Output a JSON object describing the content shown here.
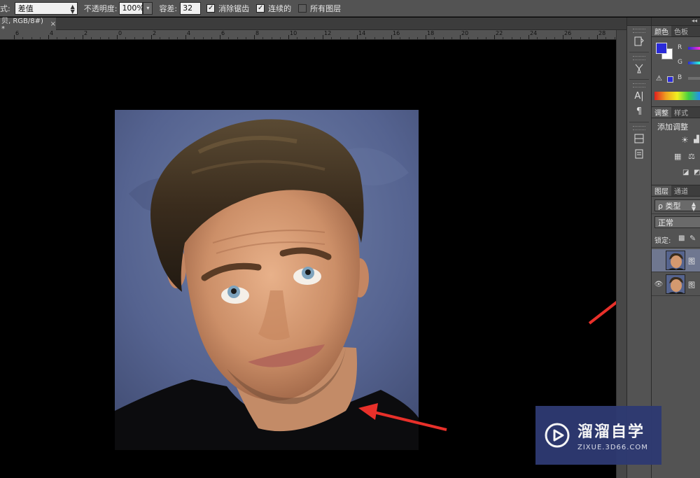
{
  "options_bar": {
    "mode_label": "式:",
    "mode_value": "差值",
    "opacity_label": "不透明度:",
    "opacity_value": "100%",
    "tolerance_label": "容差:",
    "tolerance_value": "32",
    "antialias_label": "消除锯齿",
    "antialias_checked": true,
    "contiguous_label": "连续的",
    "contiguous_checked": true,
    "all_layers_label": "所有图层",
    "all_layers_checked": false
  },
  "document_tab": {
    "title": "贝, RGB/8#) *",
    "close": "×"
  },
  "ruler": {
    "labels": [
      "6",
      "4",
      "2",
      "0",
      "2",
      "4",
      "6",
      "8",
      "10",
      "12",
      "14",
      "16",
      "18",
      "20",
      "22",
      "24",
      "26",
      "28"
    ]
  },
  "icon_strip": {
    "icons": [
      "history-icon",
      "brush-presets-icon",
      "character-icon",
      "paragraph-icon",
      "layer-comps-icon",
      "notes-icon"
    ],
    "glyphs": {
      "character": "A|",
      "paragraph": "¶"
    }
  },
  "color_panel": {
    "tabs": [
      "颜色",
      "色板"
    ],
    "channels": [
      "R",
      "G",
      "B"
    ],
    "foreground_color": "#2a2ad8",
    "background_color": "#ffffff"
  },
  "adjust_panel": {
    "tabs": [
      "调整",
      "样式"
    ],
    "add_label": "添加调整"
  },
  "layers_panel": {
    "tabs": [
      "图层",
      "通道"
    ],
    "filter_label": "ρ 类型",
    "blend_mode": "正常",
    "lock_label": "锁定:",
    "layers": [
      {
        "name": "图",
        "visible": false,
        "selected": true
      },
      {
        "name": "图",
        "visible": true,
        "selected": false
      }
    ]
  },
  "watermark": {
    "title": "溜溜自学",
    "subtitle": "ZIXUE.3D66.COM"
  }
}
